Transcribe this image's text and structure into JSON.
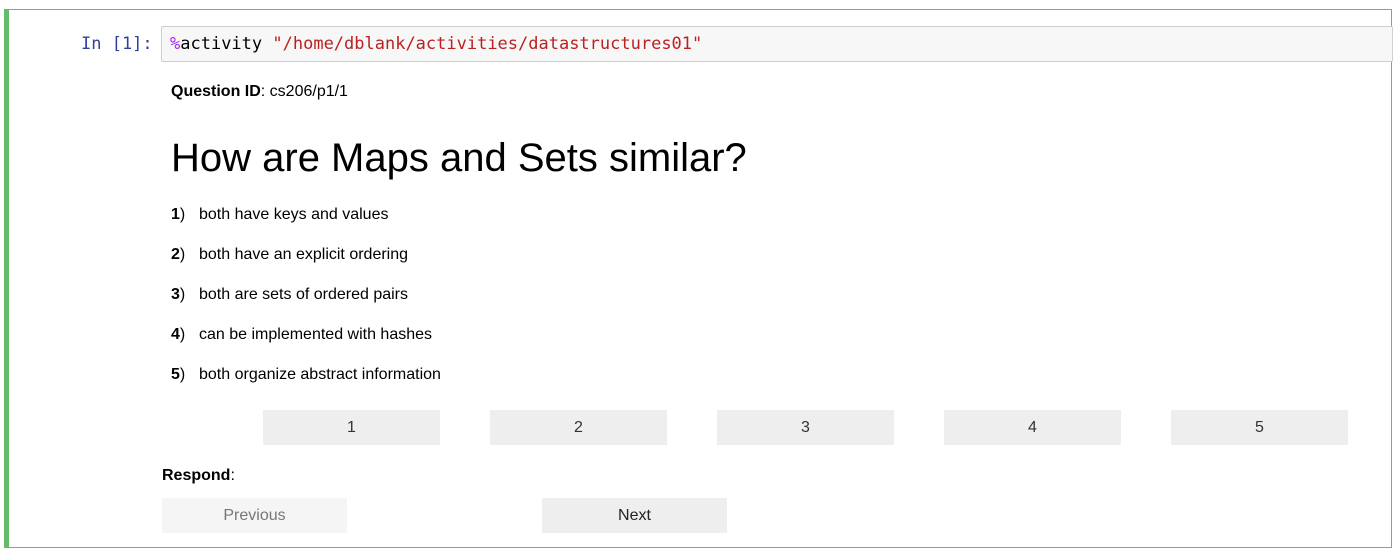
{
  "cell": {
    "prompt": "In [1]:",
    "code": {
      "magic_prefix": "%",
      "magic_name": "activity",
      "argument": "\"/home/dblank/activities/datastructures01\""
    }
  },
  "activity": {
    "question_id_label": "Question ID",
    "question_id_value": ": cs206/p1/1",
    "question": "How are Maps and Sets similar?",
    "choices": [
      {
        "num": "1",
        "text": "both have keys and values"
      },
      {
        "num": "2",
        "text": "both have an explicit ordering"
      },
      {
        "num": "3",
        "text": "both are sets of ordered pairs"
      },
      {
        "num": "4",
        "text": "can be implemented with hashes"
      },
      {
        "num": "5",
        "text": "both organize abstract information"
      }
    ],
    "answer_buttons": [
      "1",
      "2",
      "3",
      "4",
      "5"
    ],
    "respond_label": "Respond",
    "respond_colon": ":",
    "prev_label": "Previous",
    "next_label": "Next"
  },
  "colors": {
    "cell_border": "#66bb6a",
    "prompt": "#303f9f",
    "magic": "#aa22ff",
    "string": "#ba2121",
    "button_bg": "#eeeeee"
  }
}
